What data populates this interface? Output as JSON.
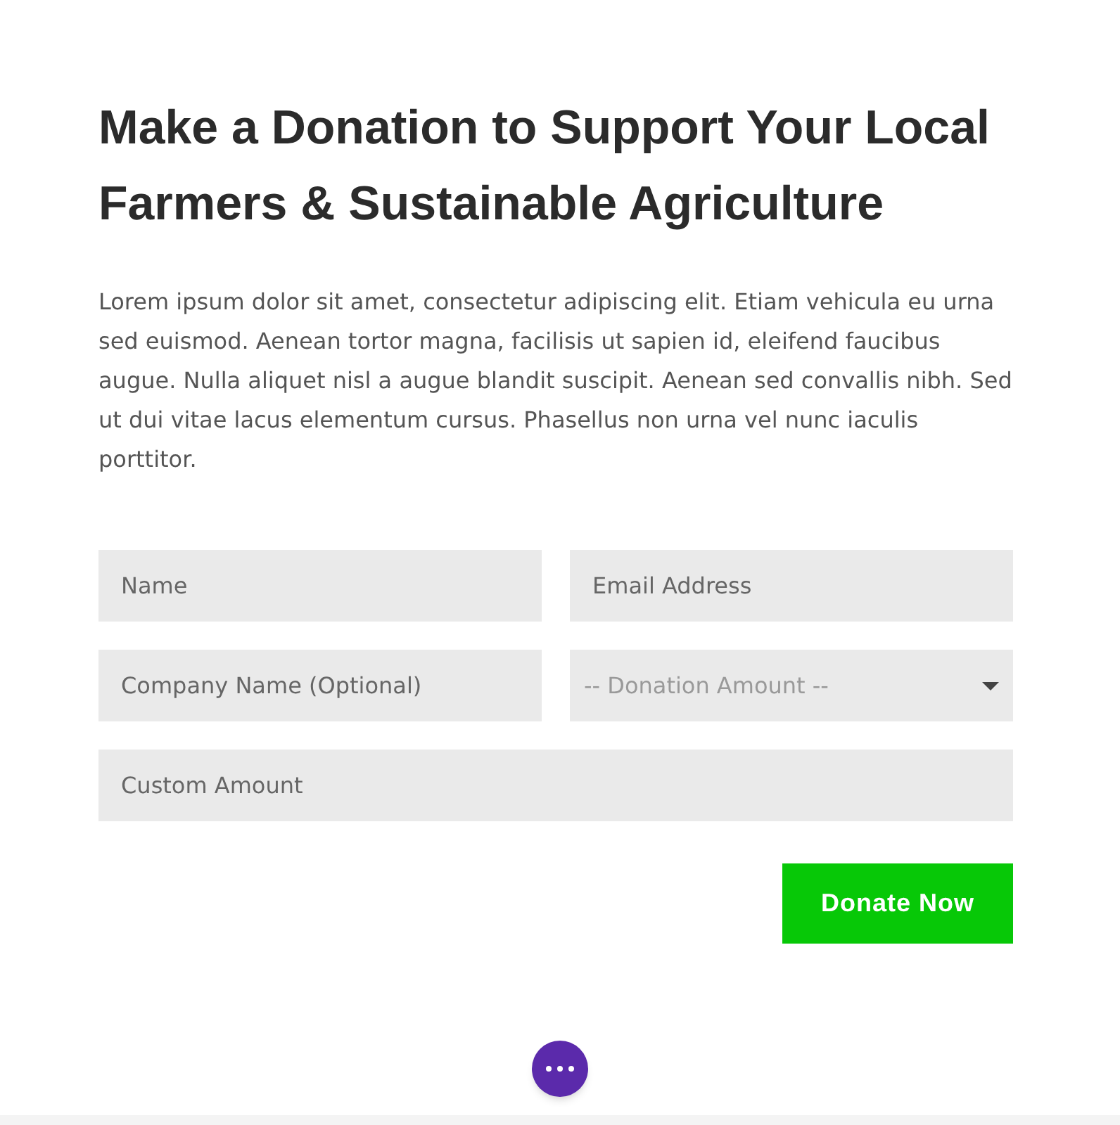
{
  "heading": "Make a Donation to Support Your Local Farmers & Sustainable Agriculture",
  "intro": "Lorem ipsum dolor sit amet, consectetur adipiscing elit. Etiam vehicula eu urna sed euismod. Aenean tortor magna, facilisis ut sapien id, eleifend faucibus augue. Nulla aliquet nisl a augue blandit suscipit. Aenean sed convallis nibh. Sed ut dui vitae lacus elementum cursus. Phasellus non urna vel nunc iaculis porttitor.",
  "form": {
    "rows": [
      [
        {
          "kind": "text",
          "placeholder": "Name"
        },
        {
          "kind": "text",
          "placeholder": "Email Address"
        }
      ],
      [
        {
          "kind": "text",
          "placeholder": "Company Name (Optional)"
        },
        {
          "kind": "select",
          "value": "-- Donation Amount --"
        }
      ],
      [
        {
          "kind": "text",
          "placeholder": "Custom Amount"
        }
      ]
    ],
    "submit": "Donate Now"
  }
}
